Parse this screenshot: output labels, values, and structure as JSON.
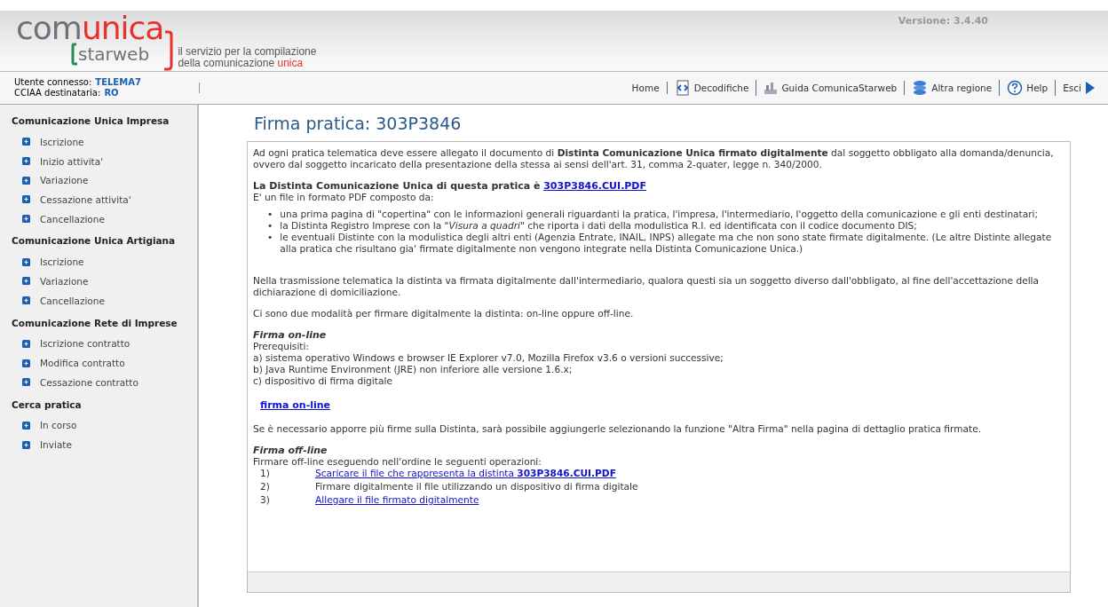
{
  "header": {
    "logo": {
      "part_1": "com",
      "part_2": "unica",
      "part_3": "starweb"
    },
    "tagline": {
      "line_1": "il servizio per la compilazione",
      "line_2": "della comunicazione",
      "highlight": "unica"
    },
    "version": "Versione: 3.4.40"
  },
  "user_bar": {
    "user_label": "Utente connesso:",
    "user": "TELEMA7",
    "cciaa_label": "CCIAA destinataria:",
    "cciaa": "RO"
  },
  "nav": [
    {
      "label": "Home",
      "kind": "plain"
    },
    {
      "label": "Decodifiche",
      "kind": "decode"
    },
    {
      "label": "Guida ComunicaStarweb",
      "kind": "guide"
    },
    {
      "label": "Altra regione",
      "kind": "region"
    },
    {
      "label": "Help",
      "kind": "help"
    },
    {
      "label": "Esci",
      "kind": "exit"
    }
  ],
  "sidebar": {
    "sections": [
      {
        "title": "Comunicazione Unica Impresa",
        "items": [
          "Iscrizione",
          "Inizio attivita'",
          "Variazione",
          "Cessazione attivita'",
          "Cancellazione"
        ]
      },
      {
        "title": "Comunicazione Unica Artigiana",
        "items": [
          "Iscrizione",
          "Variazione",
          "Cancellazione"
        ]
      },
      {
        "title": "Comunicazione Rete di Imprese",
        "items": [
          "Iscrizione contratto",
          "Modifica contratto",
          "Cessazione contratto"
        ]
      },
      {
        "title": "Cerca pratica",
        "items": [
          "In corso",
          "Inviate"
        ]
      }
    ]
  },
  "content": {
    "title": "Firma pratica: 303P3846",
    "intro": "Ad ogni pratica telematica deve essere allegato il documento di **Distinta Comunicazione Unica firmato digitalmente** dal soggetto obbligato alla domanda/denuncia, ovvero dal soggetto incaricato della presentazione della stessa ai sensi dell'art. 31, comma 2-quater, legge n. 340/2000.",
    "distinta_heading": "La Distinta Comunicazione Unica di questa pratica è",
    "distinta_link": "303P3846.CUI.PDF",
    "composition": "E' un file in formato PDF composto da:",
    "bullets": [
      {
        "marker": "•",
        "text": "una prima pagina di \"copertina\" con le informazioni generali riguardanti la pratica, l'impresa, l'intermediario, l'oggetto della comunicazione e gli enti destinatari;"
      },
      {
        "marker": "•",
        "text": "la Distinta Registro Imprese con la \"*Visura a quadri*\" che riporta i dati della modulistica R.I. ed identificata con il codice documento DIS;"
      },
      {
        "marker": "•",
        "text": "le eventuali Distinte con la modulistica degli altri enti (Agenzia Entrate, INAIL, INPS) allegate ma che non sono state firmate digitalmente. (Le altre Distinte allegate alla pratica che risultano gia' firmate digitalmente non vengono integrate nella Distinta Comunicazione Unica.)"
      }
    ],
    "transmission": "Nella trasmissione telematica la distinta va firmata digitalmente dall'intermediario, qualora questi sia un soggetto diverso dall'obbligato, al fine dell'accettazione della dichiarazione di domiciliazione.",
    "modes": "Ci sono due modalità per firmare digitalmente la distinta: on-line oppure off-line.",
    "online": {
      "heading": "Firma on-line",
      "prereq_label": "Prerequisiti:",
      "prereqs": [
        "a) sistema operativo Windows e browser IE Explorer v7.0, Mozilla Firefox v3.6 o versioni successive;",
        "b) Java Runtime Environment (JRE) non inferiore alle versione 1.6.x;",
        "c) dispositivo di firma digitale"
      ],
      "link": "firma on-line",
      "note": "Se è necessario apporre più firme sulla Distinta, sarà possibile aggiungerle selezionando la funzione \"Altra Firma\" nella pagina di dettaglio pratica firmate."
    },
    "offline": {
      "heading": "Firma off-line",
      "intro": "Firmare off-line eseguendo nell'ordine le seguenti operazioni:",
      "steps": [
        {
          "number": "1)",
          "text": "Scaricare il file che rappresenta la distinta **303P3846.CUI.PDF**",
          "kind": "link"
        },
        {
          "number": "2)",
          "text": "Firmare digitalmente il file utilizzando un dispositivo di firma digitale",
          "kind": "text"
        },
        {
          "number": "3)",
          "text": "Allegare il file firmato digitalmente",
          "kind": "link"
        }
      ]
    }
  }
}
